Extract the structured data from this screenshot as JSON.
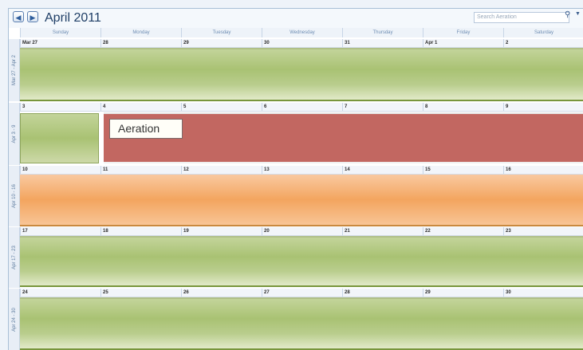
{
  "header": {
    "title": "April 2011",
    "prev_icon": "left-arrow-icon",
    "next_icon": "right-arrow-icon",
    "search_placeholder": "Search Aeration",
    "search_icon": "magnifier-icon"
  },
  "days": [
    "Sunday",
    "Monday",
    "Tuesday",
    "Wednesday",
    "Thursday",
    "Friday",
    "Saturday"
  ],
  "weeks": [
    {
      "label": "Mar 27 - Apr 2",
      "dates": [
        "Mar 27",
        "28",
        "29",
        "30",
        "31",
        "Apr 1",
        "2"
      ],
      "style": "green"
    },
    {
      "label": "Apr 3 - 9",
      "dates": [
        "3",
        "4",
        "5",
        "6",
        "7",
        "8",
        "9"
      ],
      "style": "event"
    },
    {
      "label": "Apr 10 - 16",
      "dates": [
        "10",
        "11",
        "12",
        "13",
        "14",
        "15",
        "16"
      ],
      "style": "orange"
    },
    {
      "label": "Apr 17 - 23",
      "dates": [
        "17",
        "18",
        "19",
        "20",
        "21",
        "22",
        "23"
      ],
      "style": "green"
    },
    {
      "label": "Apr 24 - 30",
      "dates": [
        "24",
        "25",
        "26",
        "27",
        "28",
        "29",
        "30"
      ],
      "style": "green"
    }
  ],
  "event": {
    "label": "Aeration",
    "color": "#c26761"
  },
  "colors": {
    "green": "#a9c273",
    "orange": "#f3a55f",
    "event_red": "#c26761"
  }
}
